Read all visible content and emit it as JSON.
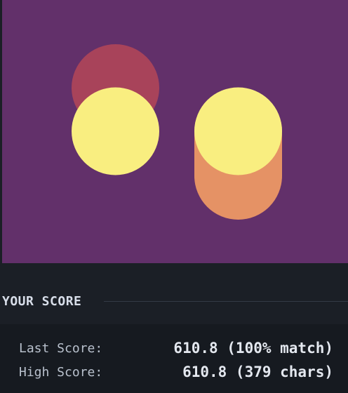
{
  "target": {
    "background_color": "#62306a",
    "shapes": [
      {
        "kind": "capsule",
        "color": "#a8435a"
      },
      {
        "kind": "capsule",
        "color": "#e59265"
      },
      {
        "kind": "circle",
        "color": "#f9ee80"
      },
      {
        "kind": "circle",
        "color": "#f9ee80"
      }
    ]
  },
  "score": {
    "title": "YOUR SCORE",
    "last_label": "Last Score:",
    "last_value": "610.8 (100% match)",
    "high_label": "High Score:",
    "high_value": "610.8 (379 chars)"
  }
}
